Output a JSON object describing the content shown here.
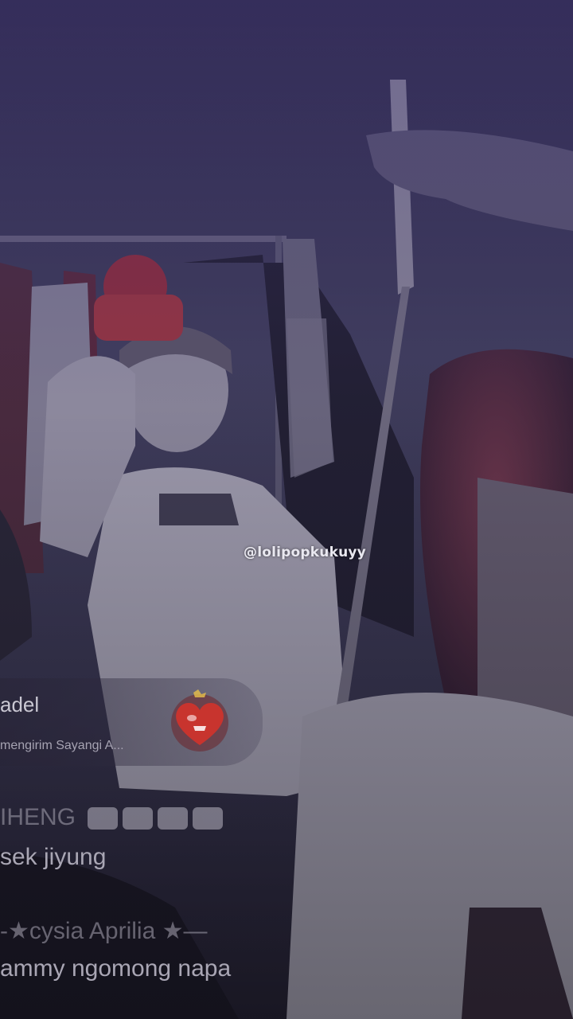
{
  "watermark": {
    "text": "@lolipopkukuyy"
  },
  "gift": {
    "user": "adel",
    "message": "mengirim Sayangi A...",
    "icon": "heart-gift-icon"
  },
  "chat": {
    "messages": [
      {
        "name": "IHENG",
        "text": "sek jiyung"
      },
      {
        "name": "-★cysia Aprilia ★—",
        "text": "ammy ngomong napa"
      }
    ]
  },
  "colors": {
    "tint": "#3c3270",
    "text": "#a9a6b4",
    "gift_red": "#c8342e"
  }
}
